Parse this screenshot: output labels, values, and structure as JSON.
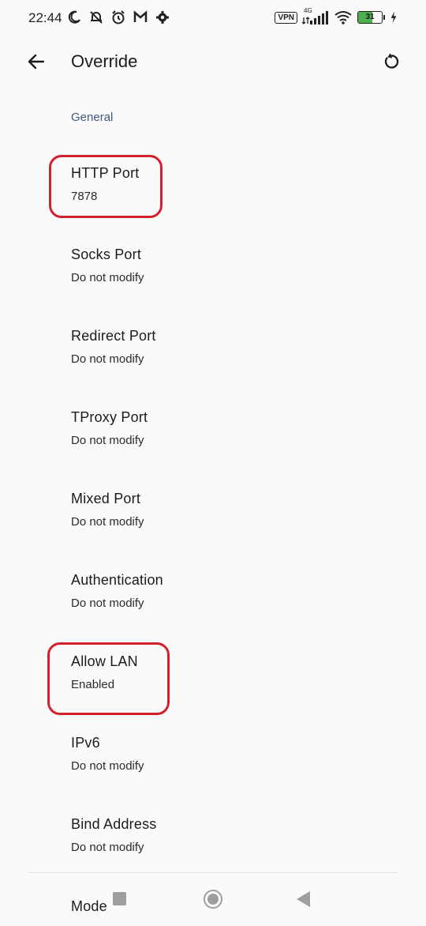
{
  "status_bar": {
    "time": "22:44",
    "vpn_label": "VPN",
    "network_label": "4G",
    "battery_level": "31",
    "battery_color": "#4caf50"
  },
  "app_bar": {
    "title": "Override",
    "back_icon": "arrow-back-icon",
    "reset_icon": "reset-icon"
  },
  "section": {
    "header": "General"
  },
  "preferences": [
    {
      "title": "HTTP Port",
      "summary": "7878"
    },
    {
      "title": "Socks Port",
      "summary": "Do not modify"
    },
    {
      "title": "Redirect Port",
      "summary": "Do not modify"
    },
    {
      "title": "TProxy Port",
      "summary": "Do not modify"
    },
    {
      "title": "Mixed Port",
      "summary": "Do not modify"
    },
    {
      "title": "Authentication",
      "summary": "Do not modify"
    },
    {
      "title": "Allow LAN",
      "summary": "Enabled"
    },
    {
      "title": "IPv6",
      "summary": "Do not modify"
    },
    {
      "title": "Bind Address",
      "summary": "Do not modify"
    }
  ],
  "partial_item": {
    "title": "Mode"
  },
  "colors": {
    "accent": "#3d5a80",
    "highlight": "#d3202a",
    "background": "#fafafa"
  }
}
